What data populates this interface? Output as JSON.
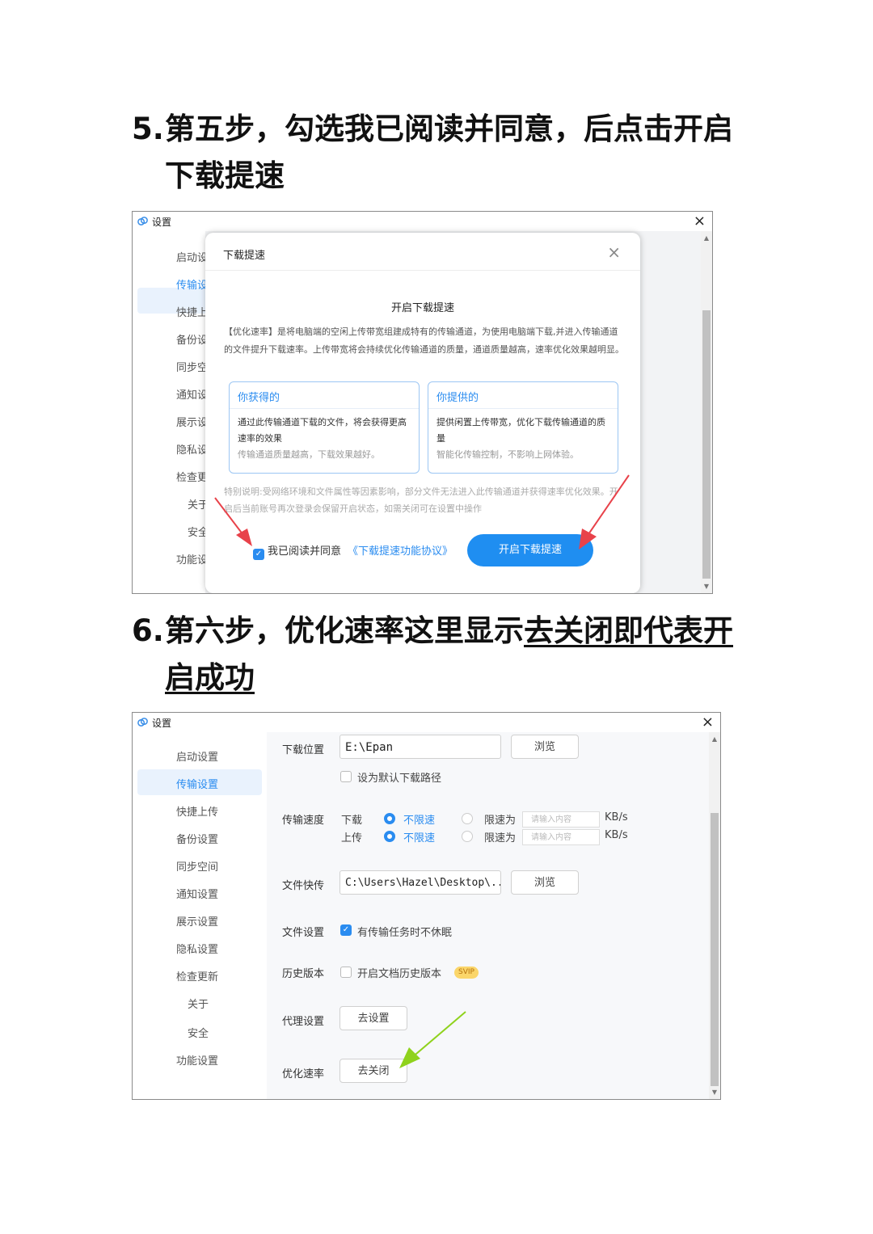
{
  "step5": {
    "num": "5.",
    "line1": "第五步，勾选我已阅读并同意，后点击开启",
    "line2": "下载提速"
  },
  "step6": {
    "num": "6.",
    "line1_plain": "第六步，优化速率这里显示",
    "line1_underlined": "去关闭即代表开",
    "line2_underlined": "启成功"
  },
  "window": {
    "title": "设置",
    "close": "×"
  },
  "sidebar_items": [
    "启动设置",
    "传输设置",
    "快捷上传",
    "备份设置",
    "同步空间",
    "通知设置",
    "展示设置",
    "隐私设置",
    "检查更新",
    "关于",
    "安全",
    "功能设置"
  ],
  "sidebar_items_truncated": [
    "启动设",
    "传输设",
    "快捷上",
    "备份设",
    "同步空",
    "通知设",
    "展示设",
    "隐私设",
    "检查更",
    "关于",
    "安全",
    "功能设"
  ],
  "dialog": {
    "title": "下载提速",
    "heading": "开启下载提速",
    "intro": "【优化速率】是将电脑端的空闲上传带宽组建成特有的传输通道，为使用电脑端下载,并进入传输通道的文件提升下载速率。上传带宽将会持续优化传输通道的质量，通道质量越高，速率优化效果越明显。",
    "card_get": {
      "title": "你获得的",
      "body": "通过此传输通道下载的文件，将会获得更高速率的效果",
      "sub": "传输通道质量越高，下载效果越好。"
    },
    "card_give": {
      "title": "你提供的",
      "body": "提供闲置上传带宽，优化下载传输通道的质量",
      "sub": "智能化传输控制，不影响上网体验。"
    },
    "note": "特别说明:受网络环境和文件属性等因素影响，部分文件无法进入此传输通道并获得速率优化效果。开启后当前账号再次登录会保留开启状态，如需关闭可在设置中操作",
    "agree_label": "我已阅读并同意",
    "agree_checked": true,
    "agreement_link": "《下载提速功能协议》",
    "enable_button": "开启下载提速"
  },
  "settings": {
    "download_location_label": "下载位置",
    "download_path": "E:\\Epan",
    "browse": "浏览",
    "set_default_label": "设为默认下载路径",
    "speed_label": "传输速度",
    "download": "下载",
    "upload": "上传",
    "unlimited": "不限速",
    "limit_to": "限速为",
    "limit_placeholder": "请输入内容",
    "unit": "KB/s",
    "quick_transfer_label": "文件快传",
    "quick_transfer_path": "C:\\Users\\Hazel\\Desktop\\...",
    "file_settings_label": "文件设置",
    "no_sleep_label": "有传输任务时不休眠",
    "no_sleep_checked": true,
    "history_label": "历史版本",
    "history_option": "开启文档历史版本",
    "svip_badge": "SVIP",
    "proxy_label": "代理设置",
    "proxy_button": "去设置",
    "optimize_label": "优化速率",
    "optimize_button": "去关闭"
  },
  "colors": {
    "accent": "#2a8cf0",
    "red_arrow": "#e8424a",
    "green_arrow": "#8fd21c"
  },
  "icons": [
    "cloud-logo-icon",
    "close-icon",
    "checkbox-checked-icon",
    "scroll-up-icon",
    "scroll-down-icon",
    "red-arrow-icon",
    "green-arrow-icon"
  ]
}
